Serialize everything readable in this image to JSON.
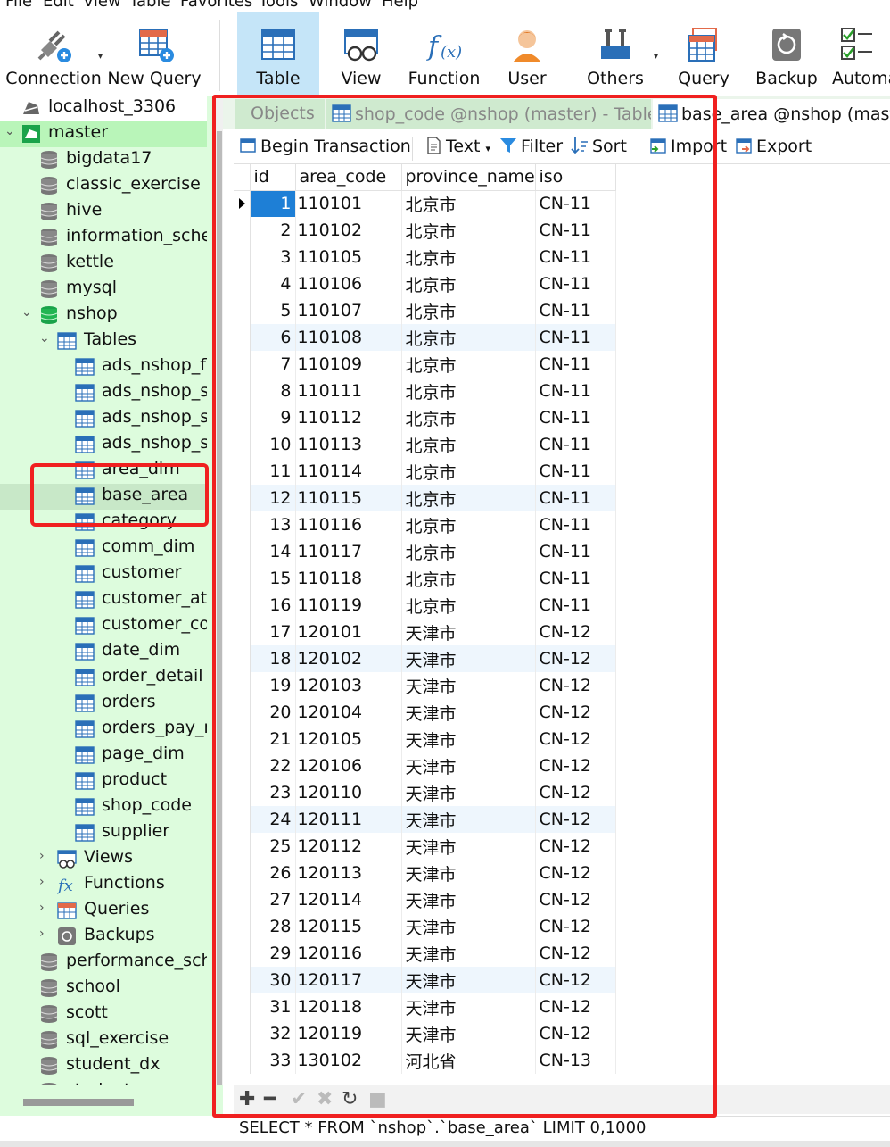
{
  "menu": [
    "File",
    "Edit",
    "View",
    "Table",
    "Favorites",
    "Tools",
    "Window",
    "Help"
  ],
  "toolbar": {
    "buttons": [
      {
        "label": "Connection",
        "icon": "connection-icon"
      },
      {
        "label": "New Query",
        "icon": "new-query-icon"
      },
      {
        "label": "Table",
        "icon": "table-icon",
        "active": true
      },
      {
        "label": "View",
        "icon": "view-icon"
      },
      {
        "label": "Function",
        "icon": "function-icon"
      },
      {
        "label": "User",
        "icon": "user-icon"
      },
      {
        "label": "Others",
        "icon": "others-icon"
      },
      {
        "label": "Query",
        "icon": "query-icon"
      },
      {
        "label": "Backup",
        "icon": "backup-icon"
      },
      {
        "label": "Automa",
        "icon": "automation-icon"
      }
    ]
  },
  "sidebar": {
    "connection": "localhost_3306",
    "master": "master",
    "databases_before": [
      "bigdata17",
      "classic_exercise",
      "hive",
      "information_schem",
      "kettle",
      "mysql"
    ],
    "nshop": "nshop",
    "tables_label": "Tables",
    "tables": [
      "ads_nshop_flc",
      "ads_nshop_se",
      "ads_nshop_se",
      "ads_nshop_se",
      "area_dim",
      "base_area",
      "category",
      "comm_dim",
      "customer",
      "customer_atte",
      "customer_con",
      "date_dim",
      "order_detail",
      "orders",
      "orders_pay_re",
      "page_dim",
      "product",
      "shop_code",
      "supplier"
    ],
    "selected_table": "base_area",
    "groups": [
      "Views",
      "Functions",
      "Queries",
      "Backups"
    ],
    "databases_after": [
      "performance_schen",
      "school",
      "scott",
      "sql_exercise",
      "student_dx",
      "students"
    ]
  },
  "tabs": [
    {
      "label": "Objects",
      "active": false
    },
    {
      "label": "shop_code @nshop (master) - Table",
      "active": false
    },
    {
      "label": "base_area @nshop (master) - Table",
      "active": true
    }
  ],
  "table_toolbar": {
    "begin_transaction": "Begin Transaction",
    "text": "Text",
    "filter": "Filter",
    "sort": "Sort",
    "import": "Import",
    "export": "Export"
  },
  "grid": {
    "columns": [
      "id",
      "area_code",
      "province_name",
      "iso"
    ],
    "rows": [
      [
        "1",
        "110101",
        "北京市",
        "CN-11"
      ],
      [
        "2",
        "110102",
        "北京市",
        "CN-11"
      ],
      [
        "3",
        "110105",
        "北京市",
        "CN-11"
      ],
      [
        "4",
        "110106",
        "北京市",
        "CN-11"
      ],
      [
        "5",
        "110107",
        "北京市",
        "CN-11"
      ],
      [
        "6",
        "110108",
        "北京市",
        "CN-11"
      ],
      [
        "7",
        "110109",
        "北京市",
        "CN-11"
      ],
      [
        "8",
        "110111",
        "北京市",
        "CN-11"
      ],
      [
        "9",
        "110112",
        "北京市",
        "CN-11"
      ],
      [
        "10",
        "110113",
        "北京市",
        "CN-11"
      ],
      [
        "11",
        "110114",
        "北京市",
        "CN-11"
      ],
      [
        "12",
        "110115",
        "北京市",
        "CN-11"
      ],
      [
        "13",
        "110116",
        "北京市",
        "CN-11"
      ],
      [
        "14",
        "110117",
        "北京市",
        "CN-11"
      ],
      [
        "15",
        "110118",
        "北京市",
        "CN-11"
      ],
      [
        "16",
        "110119",
        "北京市",
        "CN-11"
      ],
      [
        "17",
        "120101",
        "天津市",
        "CN-12"
      ],
      [
        "18",
        "120102",
        "天津市",
        "CN-12"
      ],
      [
        "19",
        "120103",
        "天津市",
        "CN-12"
      ],
      [
        "20",
        "120104",
        "天津市",
        "CN-12"
      ],
      [
        "21",
        "120105",
        "天津市",
        "CN-12"
      ],
      [
        "22",
        "120106",
        "天津市",
        "CN-12"
      ],
      [
        "23",
        "120110",
        "天津市",
        "CN-12"
      ],
      [
        "24",
        "120111",
        "天津市",
        "CN-12"
      ],
      [
        "25",
        "120112",
        "天津市",
        "CN-12"
      ],
      [
        "26",
        "120113",
        "天津市",
        "CN-12"
      ],
      [
        "27",
        "120114",
        "天津市",
        "CN-12"
      ],
      [
        "28",
        "120115",
        "天津市",
        "CN-12"
      ],
      [
        "29",
        "120116",
        "天津市",
        "CN-12"
      ],
      [
        "30",
        "120117",
        "天津市",
        "CN-12"
      ],
      [
        "31",
        "120118",
        "天津市",
        "CN-12"
      ],
      [
        "32",
        "120119",
        "天津市",
        "CN-12"
      ],
      [
        "33",
        "130102",
        "河北省",
        "CN-13"
      ]
    ]
  },
  "grid_bottom_icons": [
    "add-record-icon",
    "delete-record-icon",
    "apply-icon",
    "cancel-icon",
    "refresh-icon",
    "stop-icon"
  ],
  "status": {
    "sql": "SELECT * FROM `nshop`.`base_area` LIMIT 0,1000"
  },
  "colors": {
    "sidebar_bg": "#ddfcdd",
    "selection_blue": "#1e7fd6",
    "annotation_red": "#f02020",
    "active_toolbar": "#c5e5f8"
  }
}
